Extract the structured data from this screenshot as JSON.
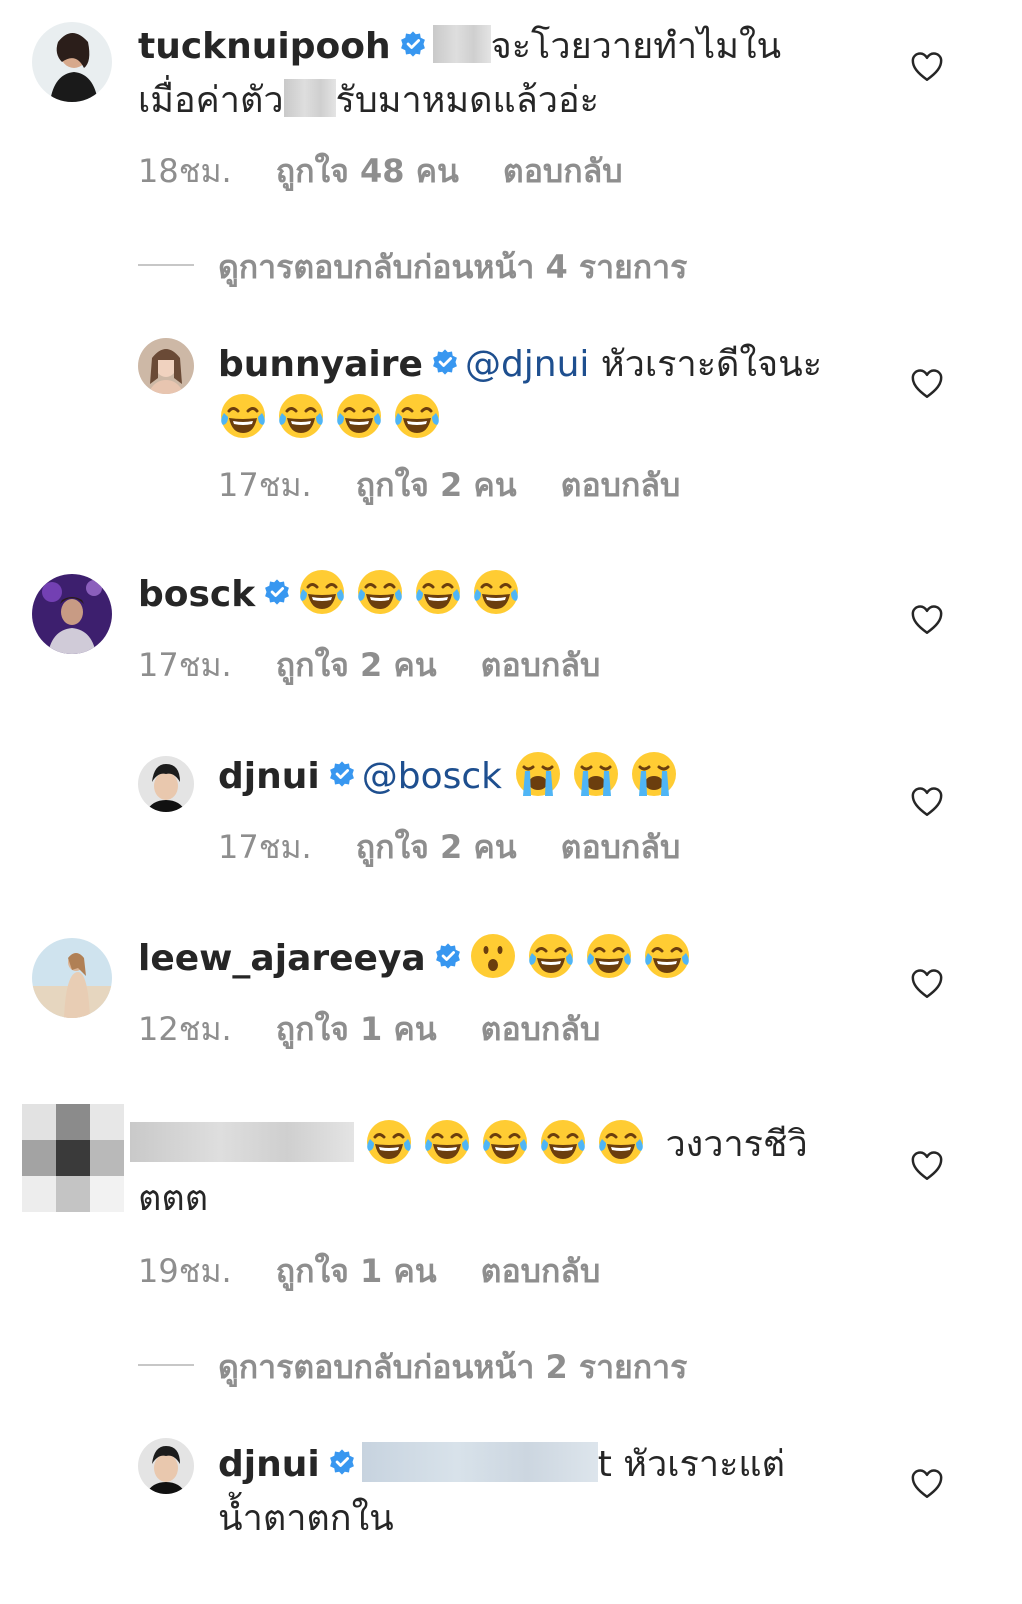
{
  "comments": [
    {
      "username": "tucknuipooh",
      "text_a": "จะโวยวายทำไมใน",
      "text_b": "เมื่อค่าตัว",
      "text_c": "รับมาหมดแล้วอ่ะ",
      "time": "18ชม.",
      "likes": "ถูกใจ 48 คน",
      "reply": "ตอบกลับ"
    },
    {
      "view_replies": "ดูการตอบกลับก่อนหน้า 4 รายการ"
    },
    {
      "username": "bunnyaire",
      "mention": "@djnui",
      "text": "หัวเราะดีใจนะ",
      "time": "17ชม.",
      "likes": "ถูกใจ 2 คน",
      "reply": "ตอบกลับ"
    },
    {
      "username": "bosck",
      "time": "17ชม.",
      "likes": "ถูกใจ 2 คน",
      "reply": "ตอบกลับ"
    },
    {
      "username": "djnui",
      "mention": "@bosck",
      "time": "17ชม.",
      "likes": "ถูกใจ 2 คน",
      "reply": "ตอบกลับ"
    },
    {
      "username": "leew_ajareeya",
      "time": "12ชม.",
      "likes": "ถูกใจ 1 คน",
      "reply": "ตอบกลับ"
    },
    {
      "text_a": "วงวารชีวิ",
      "text_b": "ตตต",
      "time": "19ชม.",
      "likes": "ถูกใจ 1 คน",
      "reply": "ตอบกลับ"
    },
    {
      "view_replies": "ดูการตอบกลับก่อนหน้า 2 รายการ"
    },
    {
      "username": "djnui",
      "text_a": "t หัวเราะแต่",
      "text_b": "น้ำตาตกใน"
    }
  ],
  "icons": {
    "like": "heart-outline-icon",
    "verified": "verified-badge-icon",
    "emoji_laugh": "face-with-tears-of-joy-icon",
    "emoji_cry": "loudly-crying-face-icon",
    "emoji_wow": "face-with-open-mouth-icon"
  },
  "colors": {
    "text": "#262626",
    "meta": "#8e8e8e",
    "mention": "#1e4f8f",
    "verified": "#3897f0"
  }
}
